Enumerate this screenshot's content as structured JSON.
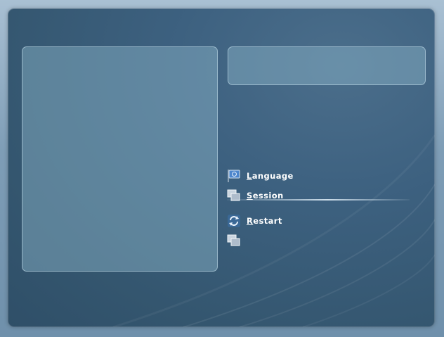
{
  "menu": {
    "language": {
      "mnemonic": "L",
      "rest": "anguage",
      "icon": "language-flag-icon"
    },
    "session": {
      "mnemonic": "S",
      "rest": "ession",
      "icon": "session-windows-icon"
    },
    "restart": {
      "mnemonic": "R",
      "rest": "estart",
      "icon": "restart-arrows-icon"
    },
    "unlabeled": {
      "icon": "windows-icon"
    }
  },
  "colors": {
    "background": "#3d6180",
    "panel": "#5f86a0",
    "text": "#ffffff"
  }
}
